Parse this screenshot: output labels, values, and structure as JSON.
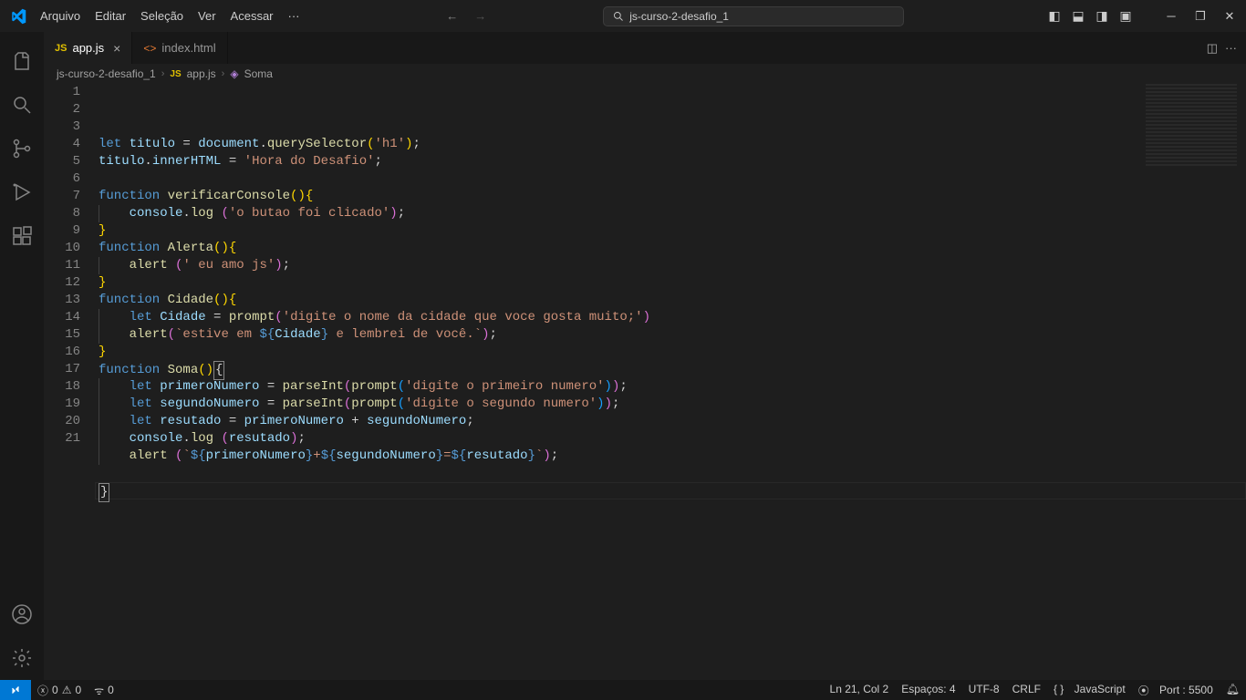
{
  "menu": [
    "Arquivo",
    "Editar",
    "Seleção",
    "Ver",
    "Acessar",
    "···"
  ],
  "search_label": "js-curso-2-desafio_1",
  "tabs": [
    {
      "name": "app.js",
      "type": "js",
      "active": true,
      "dirty": false
    },
    {
      "name": "index.html",
      "type": "html",
      "active": false,
      "dirty": false
    }
  ],
  "breadcrumbs": {
    "folder": "js-curso-2-desafio_1",
    "file": "app.js",
    "symbol": "Soma"
  },
  "code_lines": [
    [
      [
        "tk-kw",
        "let "
      ],
      [
        "tk-var",
        "titulo"
      ],
      [
        "tk-op",
        " = "
      ],
      [
        "tk-var",
        "document"
      ],
      [
        "tk-op",
        "."
      ],
      [
        "tk-fn",
        "querySelector"
      ],
      [
        "tk-brc",
        "("
      ],
      [
        "tk-str",
        "'h1'"
      ],
      [
        "tk-brc",
        ")"
      ],
      [
        "tk-op",
        ";"
      ]
    ],
    [
      [
        "tk-var",
        "titulo"
      ],
      [
        "tk-op",
        "."
      ],
      [
        "tk-var",
        "innerHTML"
      ],
      [
        "tk-op",
        " = "
      ],
      [
        "tk-str",
        "'Hora do Desafio'"
      ],
      [
        "tk-op",
        ";"
      ]
    ],
    [],
    [
      [
        "tk-kw",
        "function "
      ],
      [
        "tk-fn",
        "verificarConsole"
      ],
      [
        "tk-brc",
        "()"
      ],
      [
        "tk-brc",
        "{"
      ]
    ],
    [
      [
        "",
        "    "
      ],
      [
        "tk-var",
        "console"
      ],
      [
        "tk-op",
        "."
      ],
      [
        "tk-fn",
        "log "
      ],
      [
        "tk-brc2",
        "("
      ],
      [
        "tk-str",
        "'o butao foi clicado'"
      ],
      [
        "tk-brc2",
        ")"
      ],
      [
        "tk-op",
        ";"
      ]
    ],
    [
      [
        "tk-brc",
        "}"
      ]
    ],
    [
      [
        "tk-kw",
        "function "
      ],
      [
        "tk-fn",
        "Alerta"
      ],
      [
        "tk-brc",
        "()"
      ],
      [
        "tk-brc",
        "{"
      ]
    ],
    [
      [
        "",
        "    "
      ],
      [
        "tk-fn",
        "alert "
      ],
      [
        "tk-brc2",
        "("
      ],
      [
        "tk-str",
        "' eu amo js'"
      ],
      [
        "tk-brc2",
        ")"
      ],
      [
        "tk-op",
        ";"
      ]
    ],
    [
      [
        "tk-brc",
        "}"
      ]
    ],
    [
      [
        "tk-kw",
        "function "
      ],
      [
        "tk-fn",
        "Cidade"
      ],
      [
        "tk-brc",
        "()"
      ],
      [
        "tk-brc",
        "{"
      ]
    ],
    [
      [
        "",
        "    "
      ],
      [
        "tk-kw",
        "let "
      ],
      [
        "tk-var",
        "Cidade"
      ],
      [
        "tk-op",
        " = "
      ],
      [
        "tk-fn",
        "prompt"
      ],
      [
        "tk-brc2",
        "("
      ],
      [
        "tk-str",
        "'digite o nome da cidade que voce gosta muito;'"
      ],
      [
        "tk-brc2",
        ")"
      ]
    ],
    [
      [
        "",
        "    "
      ],
      [
        "tk-fn",
        "alert"
      ],
      [
        "tk-brc2",
        "("
      ],
      [
        "tk-str",
        "`estive em "
      ],
      [
        "tk-kw",
        "${"
      ],
      [
        "tk-var",
        "Cidade"
      ],
      [
        "tk-kw",
        "}"
      ],
      [
        "tk-str",
        " e lembrei de você.`"
      ],
      [
        "tk-brc2",
        ")"
      ],
      [
        "tk-op",
        ";"
      ]
    ],
    [
      [
        "tk-brc",
        "}"
      ]
    ],
    [
      [
        "tk-kw",
        "function "
      ],
      [
        "tk-fn",
        "Soma"
      ],
      [
        "tk-brc",
        "()"
      ],
      [
        "cursor-b",
        "{"
      ]
    ],
    [
      [
        "",
        "    "
      ],
      [
        "tk-kw",
        "let "
      ],
      [
        "tk-var",
        "primeroNumero"
      ],
      [
        "tk-op",
        " = "
      ],
      [
        "tk-fn",
        "parseInt"
      ],
      [
        "tk-brc2",
        "("
      ],
      [
        "tk-fn",
        "prompt"
      ],
      [
        "tk-brc3",
        "("
      ],
      [
        "tk-str",
        "'digite o primeiro numero'"
      ],
      [
        "tk-brc3",
        ")"
      ],
      [
        "tk-brc2",
        ")"
      ],
      [
        "tk-op",
        ";"
      ]
    ],
    [
      [
        "",
        "    "
      ],
      [
        "tk-kw",
        "let "
      ],
      [
        "tk-var",
        "segundoNumero"
      ],
      [
        "tk-op",
        " = "
      ],
      [
        "tk-fn",
        "parseInt"
      ],
      [
        "tk-brc2",
        "("
      ],
      [
        "tk-fn",
        "prompt"
      ],
      [
        "tk-brc3",
        "("
      ],
      [
        "tk-str",
        "'digite o segundo numero'"
      ],
      [
        "tk-brc3",
        ")"
      ],
      [
        "tk-brc2",
        ")"
      ],
      [
        "tk-op",
        ";"
      ]
    ],
    [
      [
        "",
        "    "
      ],
      [
        "tk-kw",
        "let "
      ],
      [
        "tk-var",
        "resutado"
      ],
      [
        "tk-op",
        " = "
      ],
      [
        "tk-var",
        "primeroNumero"
      ],
      [
        "tk-op",
        " + "
      ],
      [
        "tk-var",
        "segundoNumero"
      ],
      [
        "tk-op",
        ";"
      ]
    ],
    [
      [
        "",
        "    "
      ],
      [
        "tk-var",
        "console"
      ],
      [
        "tk-op",
        "."
      ],
      [
        "tk-fn",
        "log "
      ],
      [
        "tk-brc2",
        "("
      ],
      [
        "tk-var",
        "resutado"
      ],
      [
        "tk-brc2",
        ")"
      ],
      [
        "tk-op",
        ";"
      ]
    ],
    [
      [
        "",
        "    "
      ],
      [
        "tk-fn",
        "alert "
      ],
      [
        "tk-brc2",
        "("
      ],
      [
        "tk-str",
        "`"
      ],
      [
        "tk-kw",
        "${"
      ],
      [
        "tk-var",
        "primeroNumero"
      ],
      [
        "tk-kw",
        "}"
      ],
      [
        "tk-str",
        "+"
      ],
      [
        "tk-kw",
        "${"
      ],
      [
        "tk-var",
        "segundoNumero"
      ],
      [
        "tk-kw",
        "}"
      ],
      [
        "tk-str",
        "="
      ],
      [
        "tk-kw",
        "${"
      ],
      [
        "tk-var",
        "resutado"
      ],
      [
        "tk-kw",
        "}"
      ],
      [
        "tk-str",
        "`"
      ],
      [
        "tk-brc2",
        ")"
      ],
      [
        "tk-op",
        ";"
      ]
    ],
    [],
    [
      [
        "cursor-b",
        "}"
      ]
    ]
  ],
  "status": {
    "errors": "0",
    "warnings": "0",
    "ports": "0",
    "ln_col": "Ln 21, Col 2",
    "spaces": "Espaços: 4",
    "encoding": "UTF-8",
    "eol": "CRLF",
    "language": "JavaScript",
    "port": "Port : 5500"
  }
}
